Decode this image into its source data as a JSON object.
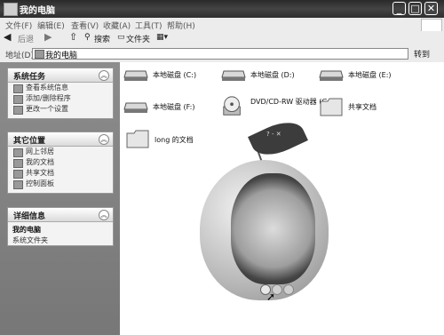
{
  "window": {
    "title": "我的电脑",
    "min": "_",
    "max": "□",
    "close": "✕"
  },
  "menu": [
    "文件(F)",
    "编辑(E)",
    "查看(V)",
    "收藏(A)",
    "工具(T)",
    "帮助(H)"
  ],
  "toolbar": {
    "back": "后退",
    "search": "搜索",
    "folders": "文件夹"
  },
  "address": {
    "label": "地址(D)",
    "value": "我的电脑",
    "go": "转到"
  },
  "panels": {
    "system_tasks": {
      "title": "系统任务",
      "items": [
        "查看系统信息",
        "添加/删除程序",
        "更改一个设置"
      ]
    },
    "other_places": {
      "title": "其它位置",
      "items": [
        "网上邻居",
        "我的文档",
        "共享文档",
        "控制面板"
      ]
    },
    "details": {
      "title": "详细信息",
      "name": "我的电脑",
      "desc": "系统文件夹"
    }
  },
  "drives": [
    {
      "label": "本地磁盘 (C:)"
    },
    {
      "label": "本地磁盘 (D:)"
    },
    {
      "label": "本地磁盘 (E:)"
    },
    {
      "label": "本地磁盘 (F:)"
    },
    {
      "label": "DVD/CD-RW 驱动器 (G:)"
    },
    {
      "label": "共享文档"
    },
    {
      "label": "long 的文档"
    }
  ],
  "widget": {
    "leaf_controls": "? - ✕"
  },
  "icons": [
    "back-icon",
    "forward-icon",
    "up-icon",
    "search-icon",
    "folders-icon",
    "views-icon",
    "chevron-up-icon",
    "drive-icon",
    "cd-icon",
    "folder-icon",
    "apple-widget",
    "cursor-icon"
  ]
}
